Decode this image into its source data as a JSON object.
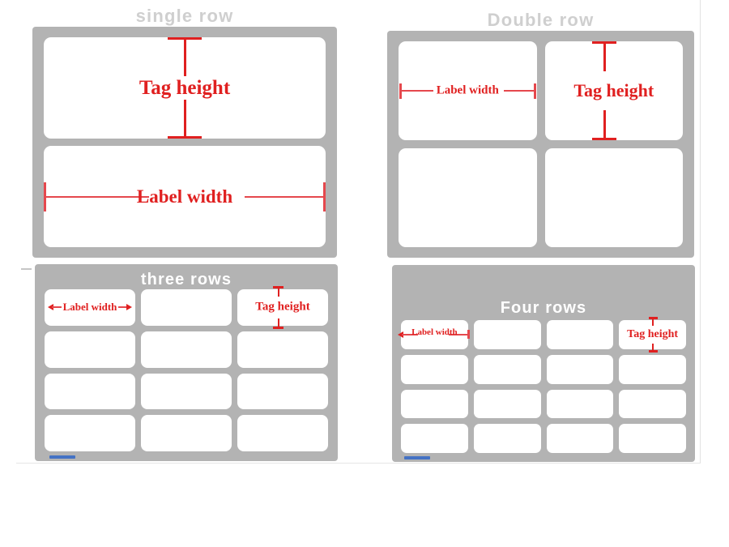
{
  "document": {
    "background_color": "#ffffff",
    "sheet_border_color": "#e2e2e2"
  },
  "colors": {
    "panel_gray": "#b3b3b3",
    "cell_white": "#ffffff",
    "annotation_red": "#e02020",
    "title_gray": "#cfcfcf",
    "title_white": "#ffffff",
    "blue_marker": "#4472c4"
  },
  "annotations": {
    "tag_height": "Tag height",
    "label_width": "Label width"
  },
  "panels": [
    {
      "id": "single",
      "title": "single row",
      "title_placement": "outside",
      "title_color": "#cfcfcf",
      "columns": 1,
      "rows": 2,
      "cells_total": 2,
      "annotated_cells": {
        "tag_height_cell": 1,
        "label_width_cell": 2
      }
    },
    {
      "id": "double",
      "title": "Double row",
      "title_placement": "outside",
      "title_color": "#cfcfcf",
      "columns": 2,
      "rows": 2,
      "cells_total": 4,
      "annotated_cells": {
        "label_width_cell": 1,
        "tag_height_cell": 2
      }
    },
    {
      "id": "three",
      "title": "three rows",
      "title_placement": "inside",
      "title_color": "#ffffff",
      "columns": 3,
      "rows": 4,
      "cells_total": 12,
      "annotated_cells": {
        "label_width_cell": 1,
        "tag_height_cell": 3
      }
    },
    {
      "id": "four",
      "title": "Four rows",
      "title_placement": "inside",
      "title_color": "#ffffff",
      "columns": 4,
      "rows": 4,
      "cells_total": 16,
      "annotated_cells": {
        "label_width_cell": 1,
        "tag_height_cell": 4
      }
    }
  ],
  "markers": {
    "blue_underline_count": 2
  }
}
